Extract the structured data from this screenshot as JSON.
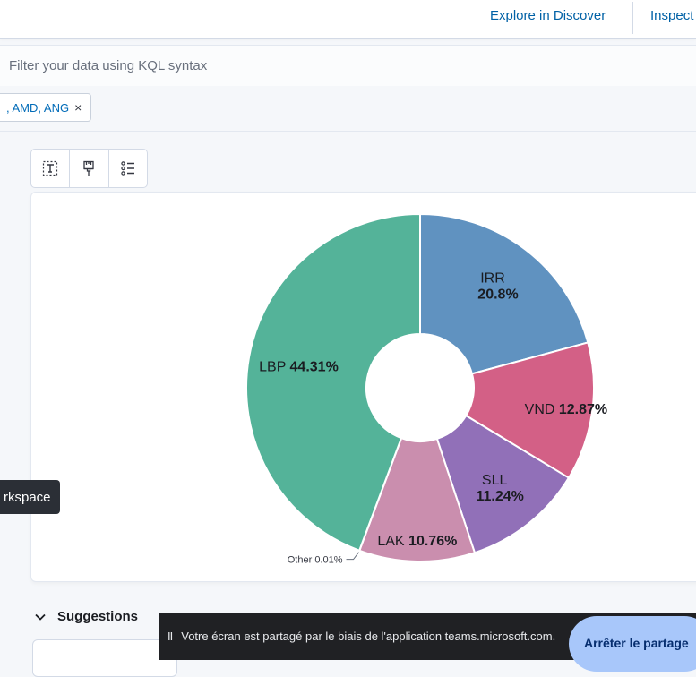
{
  "header": {
    "explore_label": "Explore in Discover",
    "inspect_label": "Inspect"
  },
  "query": {
    "placeholder": "Filter your data using KQL syntax"
  },
  "filter": {
    "pill_label": ", AMD, ANG",
    "remove_glyph": "×"
  },
  "toolbar": {
    "icons": [
      "text-format-icon",
      "brush-icon",
      "list-icon"
    ]
  },
  "chart_data": {
    "type": "pie",
    "donut": true,
    "slices": [
      {
        "name": "IRR",
        "value": 20.8,
        "color": "#6092c0"
      },
      {
        "name": "VND",
        "value": 12.87,
        "color": "#d36086"
      },
      {
        "name": "SLL",
        "value": 11.24,
        "color": "#9170b8"
      },
      {
        "name": "LAK",
        "value": 10.76,
        "color": "#ca8eae"
      },
      {
        "name": "Other",
        "value": 0.01,
        "color": "#d6bf57"
      },
      {
        "name": "LBP",
        "value": 44.31,
        "color": "#54b399"
      }
    ],
    "labels": {
      "IRR": "20.8%",
      "VND": "12.87%",
      "SLL": "11.24%",
      "LAK": "10.76%",
      "Other": "0.01%",
      "LBP": "44.31%"
    }
  },
  "tooltip": {
    "text": "rkspace"
  },
  "suggestions": {
    "title": "Suggestions"
  },
  "share_banner": {
    "pause_glyph": "II",
    "text": "Votre écran est partagé par le biais de l'application teams.microsoft.com.",
    "stop_label": "Arrêter le partage"
  }
}
